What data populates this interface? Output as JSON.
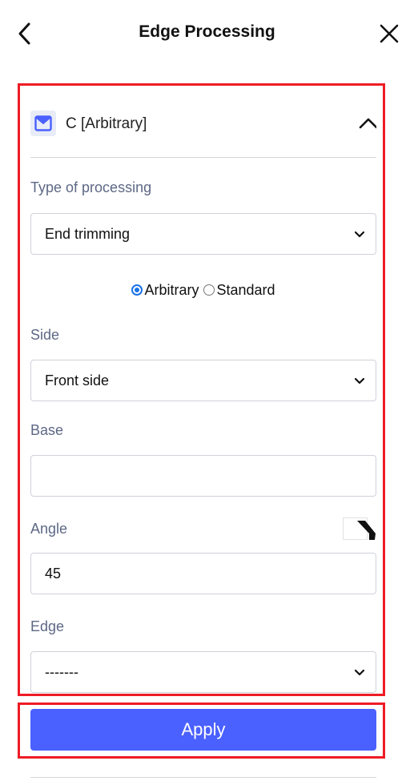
{
  "header": {
    "title": "Edge Processing",
    "back_icon": "chevron-left-icon",
    "close_icon": "close-icon"
  },
  "section": {
    "title": "C [Arbitrary]",
    "icon": "envelope-square-icon",
    "collapse_icon": "chevron-up-icon",
    "expanded": true
  },
  "fields": {
    "type_of_processing": {
      "label": "Type of processing",
      "value": "End trimming"
    },
    "mode": {
      "options": [
        {
          "label": "Arbitrary",
          "selected": true
        },
        {
          "label": "Standard",
          "selected": false
        }
      ]
    },
    "side": {
      "label": "Side",
      "value": "Front side"
    },
    "base": {
      "label": "Base",
      "value": ""
    },
    "angle": {
      "label": "Angle",
      "value": "45",
      "icon": "angle-bevel-icon"
    },
    "edge": {
      "label": "Edge",
      "value": "-------"
    }
  },
  "actions": {
    "apply_label": "Apply"
  },
  "colors": {
    "highlight_border": "#ee1c25",
    "apply_button": "#4a60ff",
    "radio_accent": "#1a73e8",
    "label_text": "#5d6885"
  }
}
